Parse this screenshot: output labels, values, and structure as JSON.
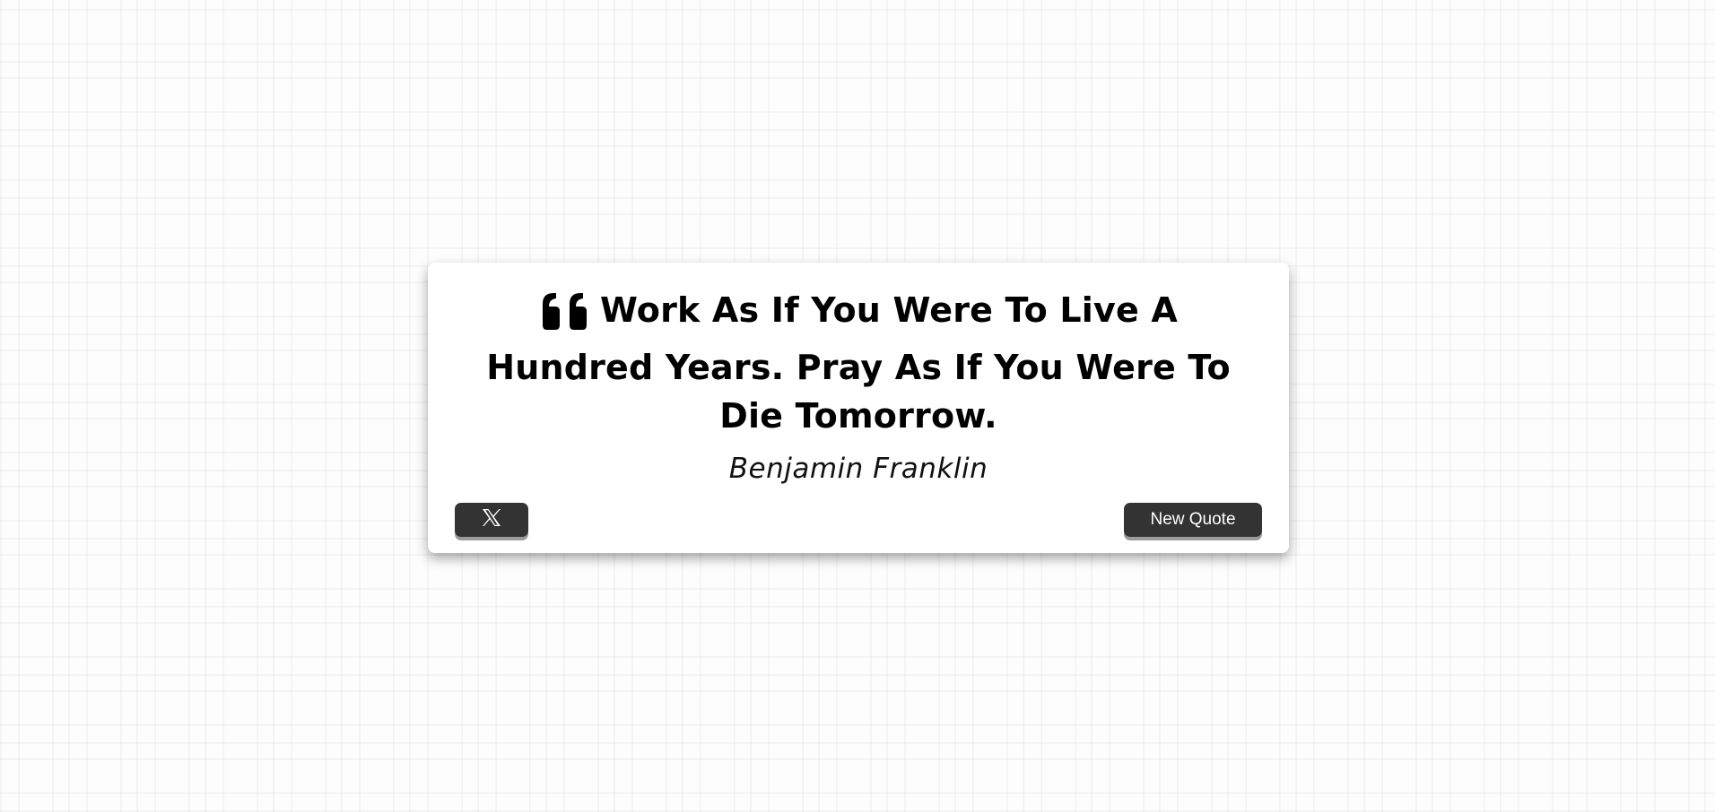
{
  "quote": {
    "text": "Work As If You Were To Live A Hundred Years. Pray As If You Were To Die Tomorrow.",
    "author": "Benjamin Franklin",
    "quote_icon": "quote-left-icon"
  },
  "actions": {
    "tweet_icon": "x-logo-icon",
    "new_quote_label": "New Quote"
  },
  "colors": {
    "button_bg": "#333333",
    "button_text": "#ffffff",
    "text": "#000000",
    "card_bg": "#ffffff"
  }
}
